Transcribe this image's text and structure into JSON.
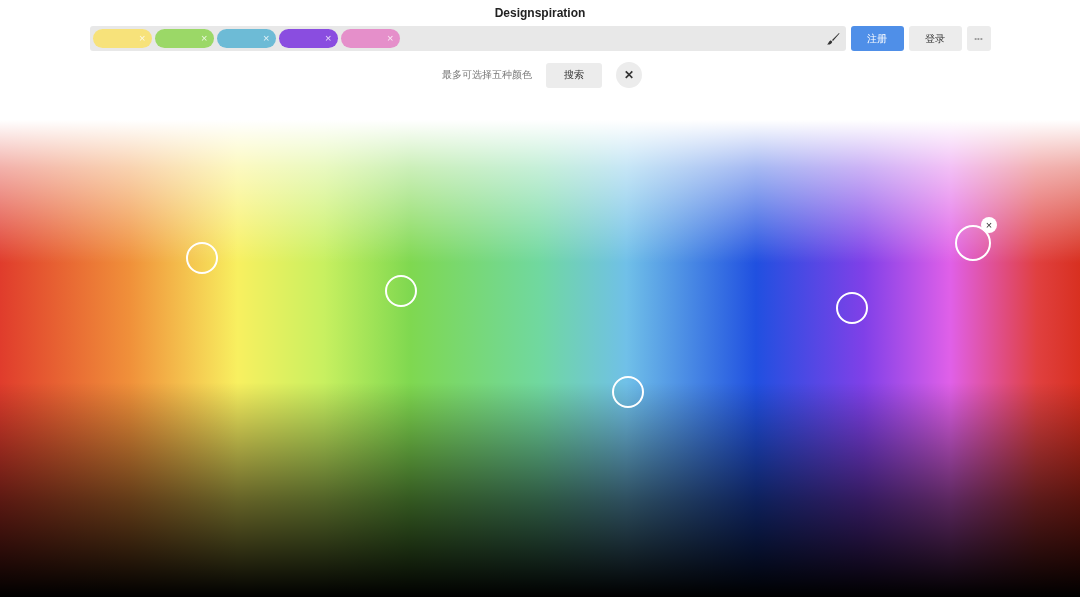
{
  "title": "Designspiration",
  "chips": [
    {
      "color": "#f7e27a",
      "remove": "×"
    },
    {
      "color": "#9bd867",
      "remove": "×"
    },
    {
      "color": "#6dbbd6",
      "remove": "×"
    },
    {
      "color": "#8a4de0",
      "remove": "×"
    },
    {
      "color": "#e58fca",
      "remove": "×"
    }
  ],
  "buttons": {
    "signup": "注册",
    "login": "登录",
    "more": "•••"
  },
  "hint": "最多可选择五种颜色",
  "search": "搜索",
  "clear": "✕",
  "markers": [
    {
      "selected": false
    },
    {
      "selected": false
    },
    {
      "selected": false
    },
    {
      "selected": false
    },
    {
      "selected": true,
      "remove": "×"
    }
  ]
}
